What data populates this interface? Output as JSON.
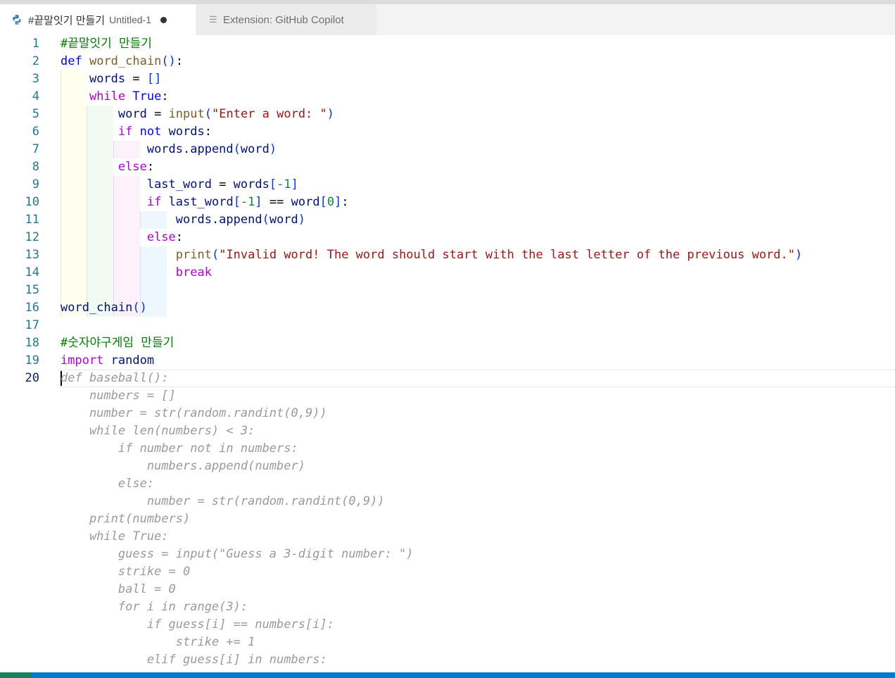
{
  "tabs": {
    "active": {
      "title": "#끝말잇기 만들기",
      "subtitle": "Untitled-1"
    },
    "inactive": {
      "title": "Extension: GitHub Copilot"
    }
  },
  "editor": {
    "line_numbers": [
      "1",
      "2",
      "3",
      "4",
      "5",
      "6",
      "7",
      "8",
      "9",
      "10",
      "11",
      "12",
      "13",
      "14",
      "15",
      "16",
      "17",
      "18",
      "19",
      "20"
    ],
    "current_line": "20",
    "code": {
      "l1": "#끝말잇기 만들기",
      "l2_def": "def",
      "l2_name": "word_chain",
      "l3_var": "words",
      "l4_while": "while",
      "l4_true": "True",
      "l5_var": "word",
      "l5_fn": "input",
      "l5_str": "\"Enter a word: \"",
      "l6_if": "if",
      "l6_not": "not",
      "l6_var": "words",
      "l7": "words.append",
      "l7_arg": "word",
      "l8_else": "else",
      "l9_var": "last_word",
      "l9_words": "words",
      "l10_if": "if",
      "l10_var": "last_word",
      "l10_word": "word",
      "l11": "words.append",
      "l11_arg": "word",
      "l12_else": "else",
      "l13_fn": "print",
      "l13_str": "\"Invalid word! The word should start with the last letter of the previous word.\"",
      "l14_break": "break",
      "l16": "word_chain",
      "l18": "#숫자야구게임 만들기",
      "l19_import": "import",
      "l19_mod": "random"
    },
    "ghost_suggestion": [
      "def baseball():",
      "    numbers = []",
      "    number = str(random.randint(0,9))",
      "    while len(numbers) < 3:",
      "        if number not in numbers:",
      "            numbers.append(number)",
      "        else:",
      "            number = str(random.randint(0,9))",
      "    print(numbers)",
      "    while True:",
      "        guess = input(\"Guess a 3-digit number: \")",
      "        strike = 0",
      "        ball = 0",
      "        for i in range(3):",
      "            if guess[i] == numbers[i]:",
      "                strike += 1",
      "            elif guess[i] in numbers:"
    ]
  },
  "colors": {
    "keyword": "#0000ff",
    "control": "#af00db",
    "function": "#795e26",
    "string": "#a31515",
    "comment": "#008000",
    "statusbar": "#007acc"
  }
}
